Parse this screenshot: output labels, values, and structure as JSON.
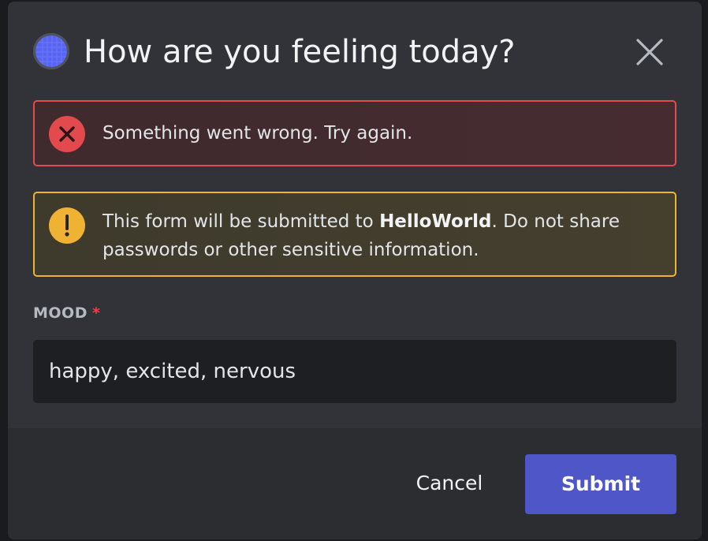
{
  "modal": {
    "title": "How are you feeling today?",
    "app_avatar_icon": "app-avatar-icon",
    "close_icon": "close-icon"
  },
  "error_alert": {
    "icon": "error-x-icon",
    "color": "#e44b4e",
    "message": "Something went wrong. Try again."
  },
  "warning_alert": {
    "icon": "warning-exclamation-icon",
    "color": "#f0b232",
    "text_prefix": "This form will be submitted to ",
    "app_name": "HelloWorld",
    "text_suffix": ". Do not share passwords or other sensitive information."
  },
  "mood_field": {
    "label": "MOOD",
    "required_marker": "*",
    "value": "happy, excited, nervous"
  },
  "footer": {
    "cancel_label": "Cancel",
    "submit_label": "Submit",
    "submit_color": "#4e56c8"
  }
}
